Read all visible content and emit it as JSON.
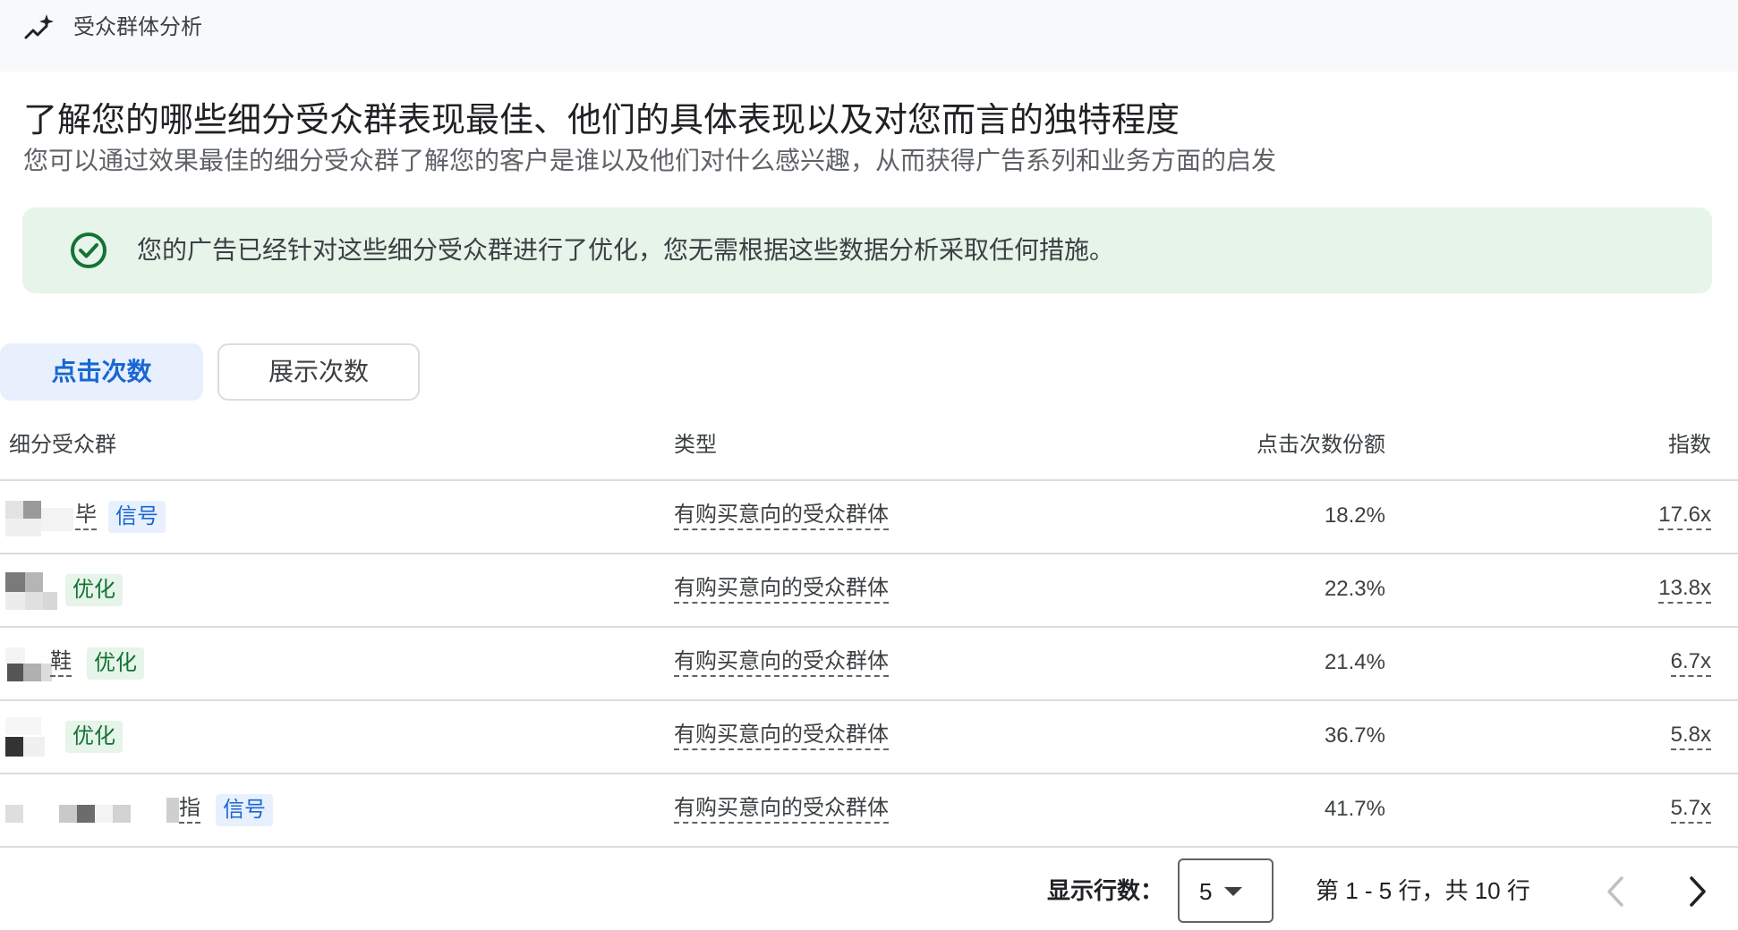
{
  "header": {
    "icon": "insights-sparkle-icon",
    "title": "受众群体分析"
  },
  "main": {
    "title": "了解您的哪些细分受众群表现最佳、他们的具体表现以及对您而言的独特程度",
    "subtitle": "您可以通过效果最佳的细分受众群了解您的客户是谁以及他们对什么感兴趣，从而获得广告系列和业务方面的启发"
  },
  "banner": {
    "icon": "check-circle-icon",
    "text": "您的广告已经针对这些细分受众群进行了优化，您无需根据这些数据分析采取任何措施。",
    "color": "#e6f4ea",
    "icon_color": "#137333"
  },
  "tabs": [
    {
      "label": "点击次数",
      "active": true
    },
    {
      "label": "展示次数",
      "active": false
    }
  ],
  "table": {
    "columns": [
      "细分受众群",
      "类型",
      "点击次数份额",
      "指数"
    ],
    "rows": [
      {
        "segment_fragment": "毕",
        "tag": "信号",
        "tag_kind": "signal",
        "type": "有购买意向的受众群体",
        "share": "18.2%",
        "index": "17.6x"
      },
      {
        "segment_fragment": "",
        "tag": "优化",
        "tag_kind": "optimized",
        "type": "有购买意向的受众群体",
        "share": "22.3%",
        "index": "13.8x"
      },
      {
        "segment_fragment": "鞋",
        "tag": "优化",
        "tag_kind": "optimized",
        "type": "有购买意向的受众群体",
        "share": "21.4%",
        "index": "6.7x"
      },
      {
        "segment_fragment": "",
        "tag": "优化",
        "tag_kind": "optimized",
        "type": "有购买意向的受众群体",
        "share": "36.7%",
        "index": "5.8x"
      },
      {
        "segment_fragment": "指",
        "tag": "信号",
        "tag_kind": "signal",
        "type": "有购买意向的受众群体",
        "share": "41.7%",
        "index": "5.7x"
      }
    ]
  },
  "pagination": {
    "rows_label": "显示行数：",
    "rows_per_page": "5",
    "range_text": "第 1 - 5 行，共 10 行"
  },
  "colors": {
    "signal_tag_bg": "#e8f0fe",
    "signal_tag_text": "#1967d2",
    "optimized_tag_bg": "#e6f4ea",
    "optimized_tag_text": "#137333",
    "active_tab_bg": "#e8f0fe"
  }
}
